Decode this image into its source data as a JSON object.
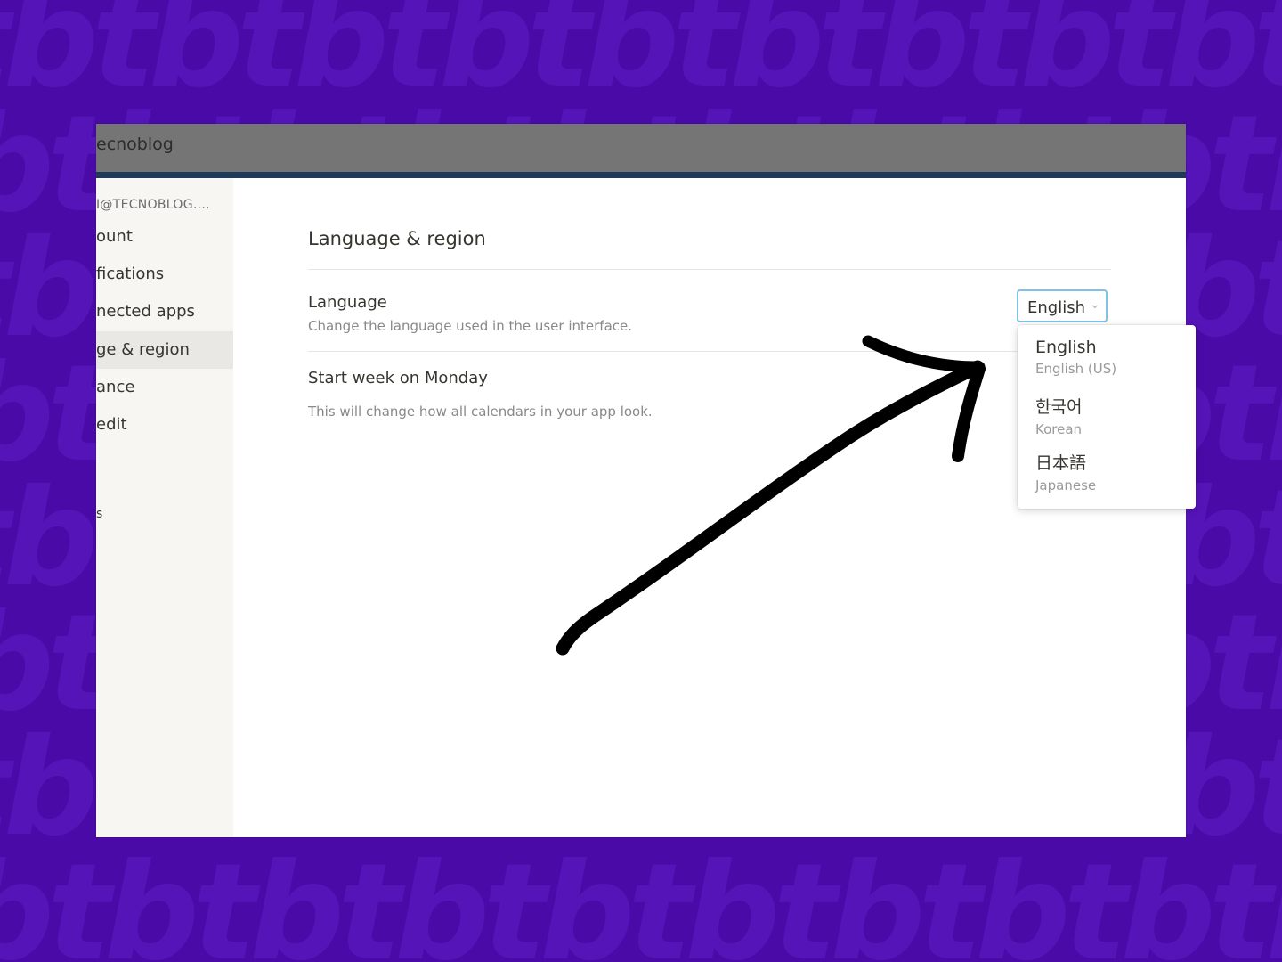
{
  "window": {
    "title": "ecnoblog"
  },
  "sidebar": {
    "email": "I@TECNOBLOG....",
    "items": [
      {
        "label": "ount"
      },
      {
        "label": "fications"
      },
      {
        "label": "nected apps"
      },
      {
        "label": "ge & region",
        "active": true
      },
      {
        "label": "ance"
      },
      {
        "label": "edit"
      },
      {
        "label": "s"
      }
    ]
  },
  "content": {
    "section_title": "Language & region",
    "language": {
      "label": "Language",
      "description": "Change the language used in the user interface.",
      "selected": "English"
    },
    "week": {
      "label": "Start week on Monday",
      "description": "This will change how all calendars in your app look."
    }
  },
  "dropdown": {
    "options": [
      {
        "name": "English",
        "sub": "English (US)"
      },
      {
        "name": "한국어",
        "sub": "Korean"
      },
      {
        "name": "日本語",
        "sub": "Japanese"
      }
    ]
  },
  "background": {
    "watermark": "tbtbtbtbtbtbtbtbtbtbtbtbtbtbtbtbtbtbtb"
  },
  "colors": {
    "background": "#4a0aa8",
    "accent_border": "#7fc2e8",
    "sidebar_bg": "#f7f6f3",
    "titlebar_bg": "#757575"
  }
}
